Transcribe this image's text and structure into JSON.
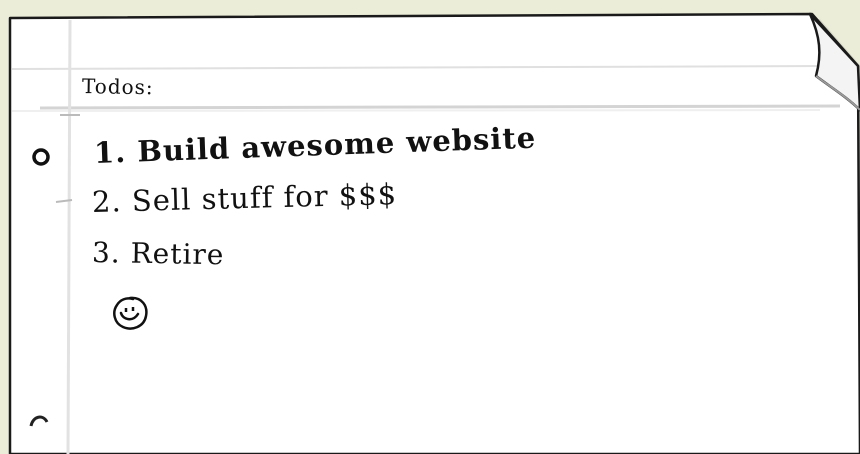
{
  "note": {
    "title": "Todos:",
    "items": [
      {
        "label": "1. Build awesome website"
      },
      {
        "label": "2. Sell stuff for $$$"
      },
      {
        "label": "3. Retire"
      }
    ]
  },
  "icons": [
    "punch-hole-icon",
    "smiley-face-icon",
    "page-curl-icon"
  ],
  "colors": {
    "background": "#ecedd8",
    "paper": "#ffffff",
    "ink": "#111111",
    "rule": "#d8d8d8"
  }
}
